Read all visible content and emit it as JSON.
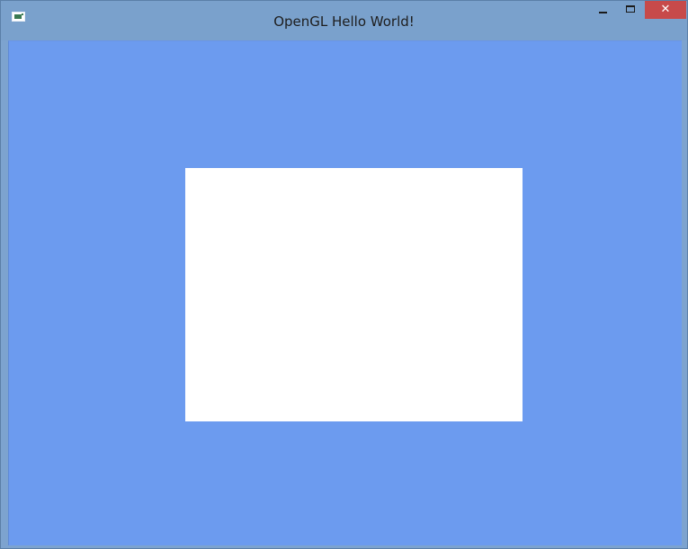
{
  "window": {
    "title": "OpenGL Hello World!"
  },
  "titlebar": {
    "icon": "application-icon",
    "buttons": {
      "minimize_icon": "minimize-icon",
      "maximize_icon": "maximize-icon",
      "close_icon": "close-icon",
      "close_glyph": "✕"
    }
  },
  "colors": {
    "titlebar": "#7aa1cc",
    "client_background": "#6c9bef",
    "quad": "#ffffff",
    "close_button": "#c74a4a"
  }
}
